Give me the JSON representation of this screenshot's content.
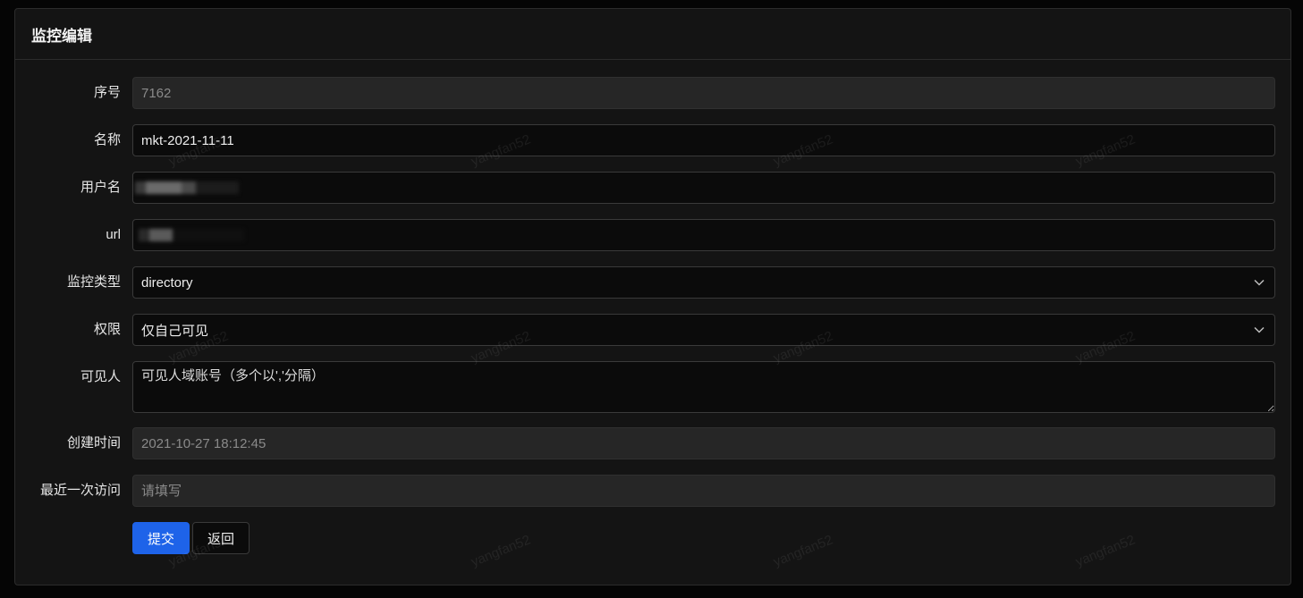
{
  "header": {
    "title": "监控编辑"
  },
  "watermark": "yangfan52",
  "form": {
    "id": {
      "label": "序号",
      "value": "7162"
    },
    "name": {
      "label": "名称",
      "value": "mkt-2021-11-11"
    },
    "username": {
      "label": "用户名",
      "value": ""
    },
    "url": {
      "label": "url",
      "value": ""
    },
    "monitor_type": {
      "label": "监控类型",
      "value": "directory"
    },
    "permission": {
      "label": "权限",
      "value": "仅自己可见"
    },
    "visible_to": {
      "label": "可见人",
      "placeholder": "可见人域账号（多个以','分隔）"
    },
    "created_at": {
      "label": "创建时间",
      "value": "2021-10-27 18:12:45"
    },
    "last_visit": {
      "label": "最近一次访问",
      "placeholder": "请填写"
    }
  },
  "actions": {
    "submit_label": "提交",
    "back_label": "返回"
  },
  "colors": {
    "primary": "#1e63e9",
    "card_bg": "#141414",
    "page_bg": "#050505"
  },
  "icons": {
    "select_arrow": "chevron-down-icon"
  }
}
